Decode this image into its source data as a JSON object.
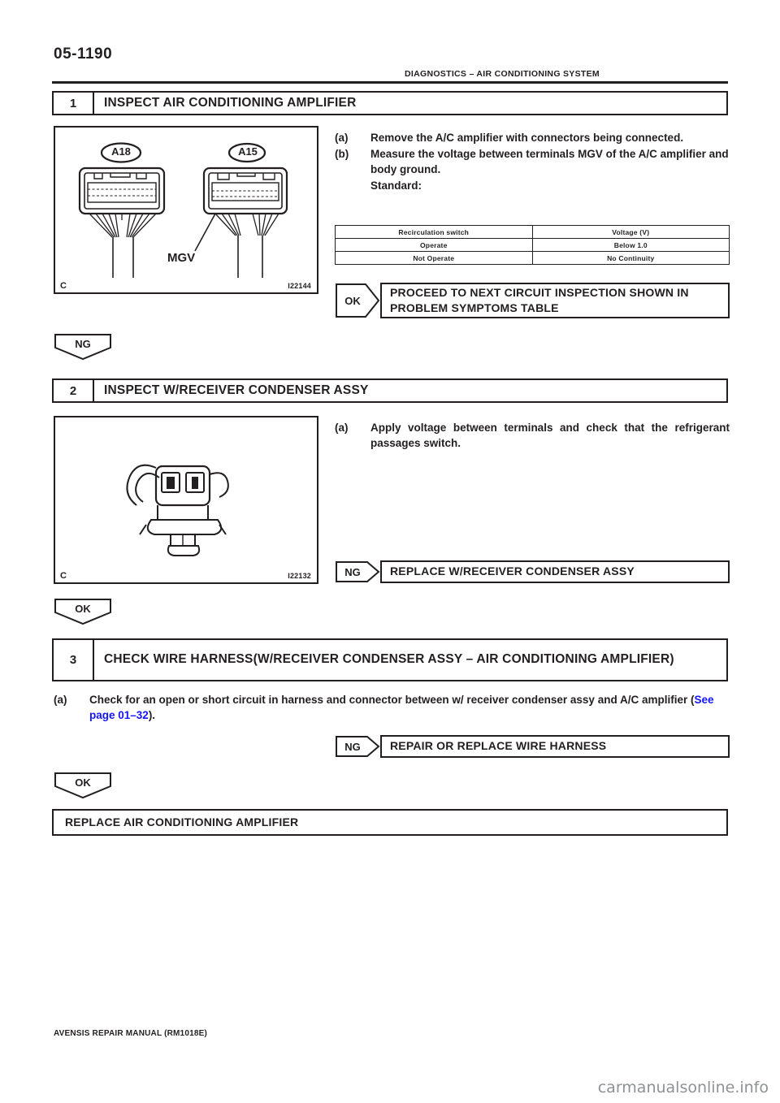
{
  "page": {
    "number": "05-1190",
    "header_title": "DIAGNOSTICS  –  AIR CONDITIONING SYSTEM",
    "footer": "AVENSIS REPAIR MANUAL   (RM1018E)",
    "watermark": "carmanualsonline.info"
  },
  "steps": [
    {
      "number": "1",
      "title": "INSPECT AIR CONDITIONING AMPLIFIER",
      "figure": {
        "corner_mark": "C",
        "code": "I22144",
        "connector_left": "A18",
        "connector_right": "A15",
        "terminal_label": "MGV"
      },
      "instructions": [
        {
          "label": "(a)",
          "text": "Remove the A/C amplifier with connectors being connected."
        },
        {
          "label": "(b)",
          "text": "Measure the voltage between terminals MGV of the A/C amplifier and body ground."
        }
      ],
      "standard_label": "Standard:",
      "table": {
        "headers": [
          "Recirculation switch",
          "Voltage (V)"
        ],
        "rows": [
          [
            "Operate",
            "Below 1.0"
          ],
          [
            "Not Operate",
            "No Continuity"
          ]
        ]
      },
      "result": {
        "tag": "OK",
        "text": "PROCEED TO NEXT CIRCUIT INSPECTION SHOWN IN PROBLEM SYMPTOMS TABLE"
      },
      "branch": "NG"
    },
    {
      "number": "2",
      "title": "INSPECT W/RECEIVER CONDENSER ASSY",
      "figure": {
        "corner_mark": "C",
        "code": "I22132"
      },
      "instructions": [
        {
          "label": "(a)",
          "text": "Apply voltage between terminals and check that the refrigerant passages switch."
        }
      ],
      "result": {
        "tag": "NG",
        "text": "REPLACE W/RECEIVER CONDENSER ASSY"
      },
      "branch": "OK"
    },
    {
      "number": "3",
      "title": "CHECK WIRE HARNESS(W/RECEIVER CONDENSER ASSY – AIR CONDITIONING AMPLIFIER)",
      "instructions": [
        {
          "label": "(a)",
          "text_before": "Check for an open or short circuit in harness and connector between w/ receiver condenser assy and A/C amplifier (",
          "link": "See page 01–32",
          "text_after": ")."
        }
      ],
      "result": {
        "tag": "NG",
        "text": "REPAIR OR REPLACE WIRE HARNESS"
      },
      "branch": "OK"
    }
  ],
  "final": {
    "text": "REPLACE AIR CONDITIONING AMPLIFIER"
  },
  "colors": {
    "ink": "#231f20",
    "link": "#1414ff",
    "watermark": "#8e9294"
  }
}
